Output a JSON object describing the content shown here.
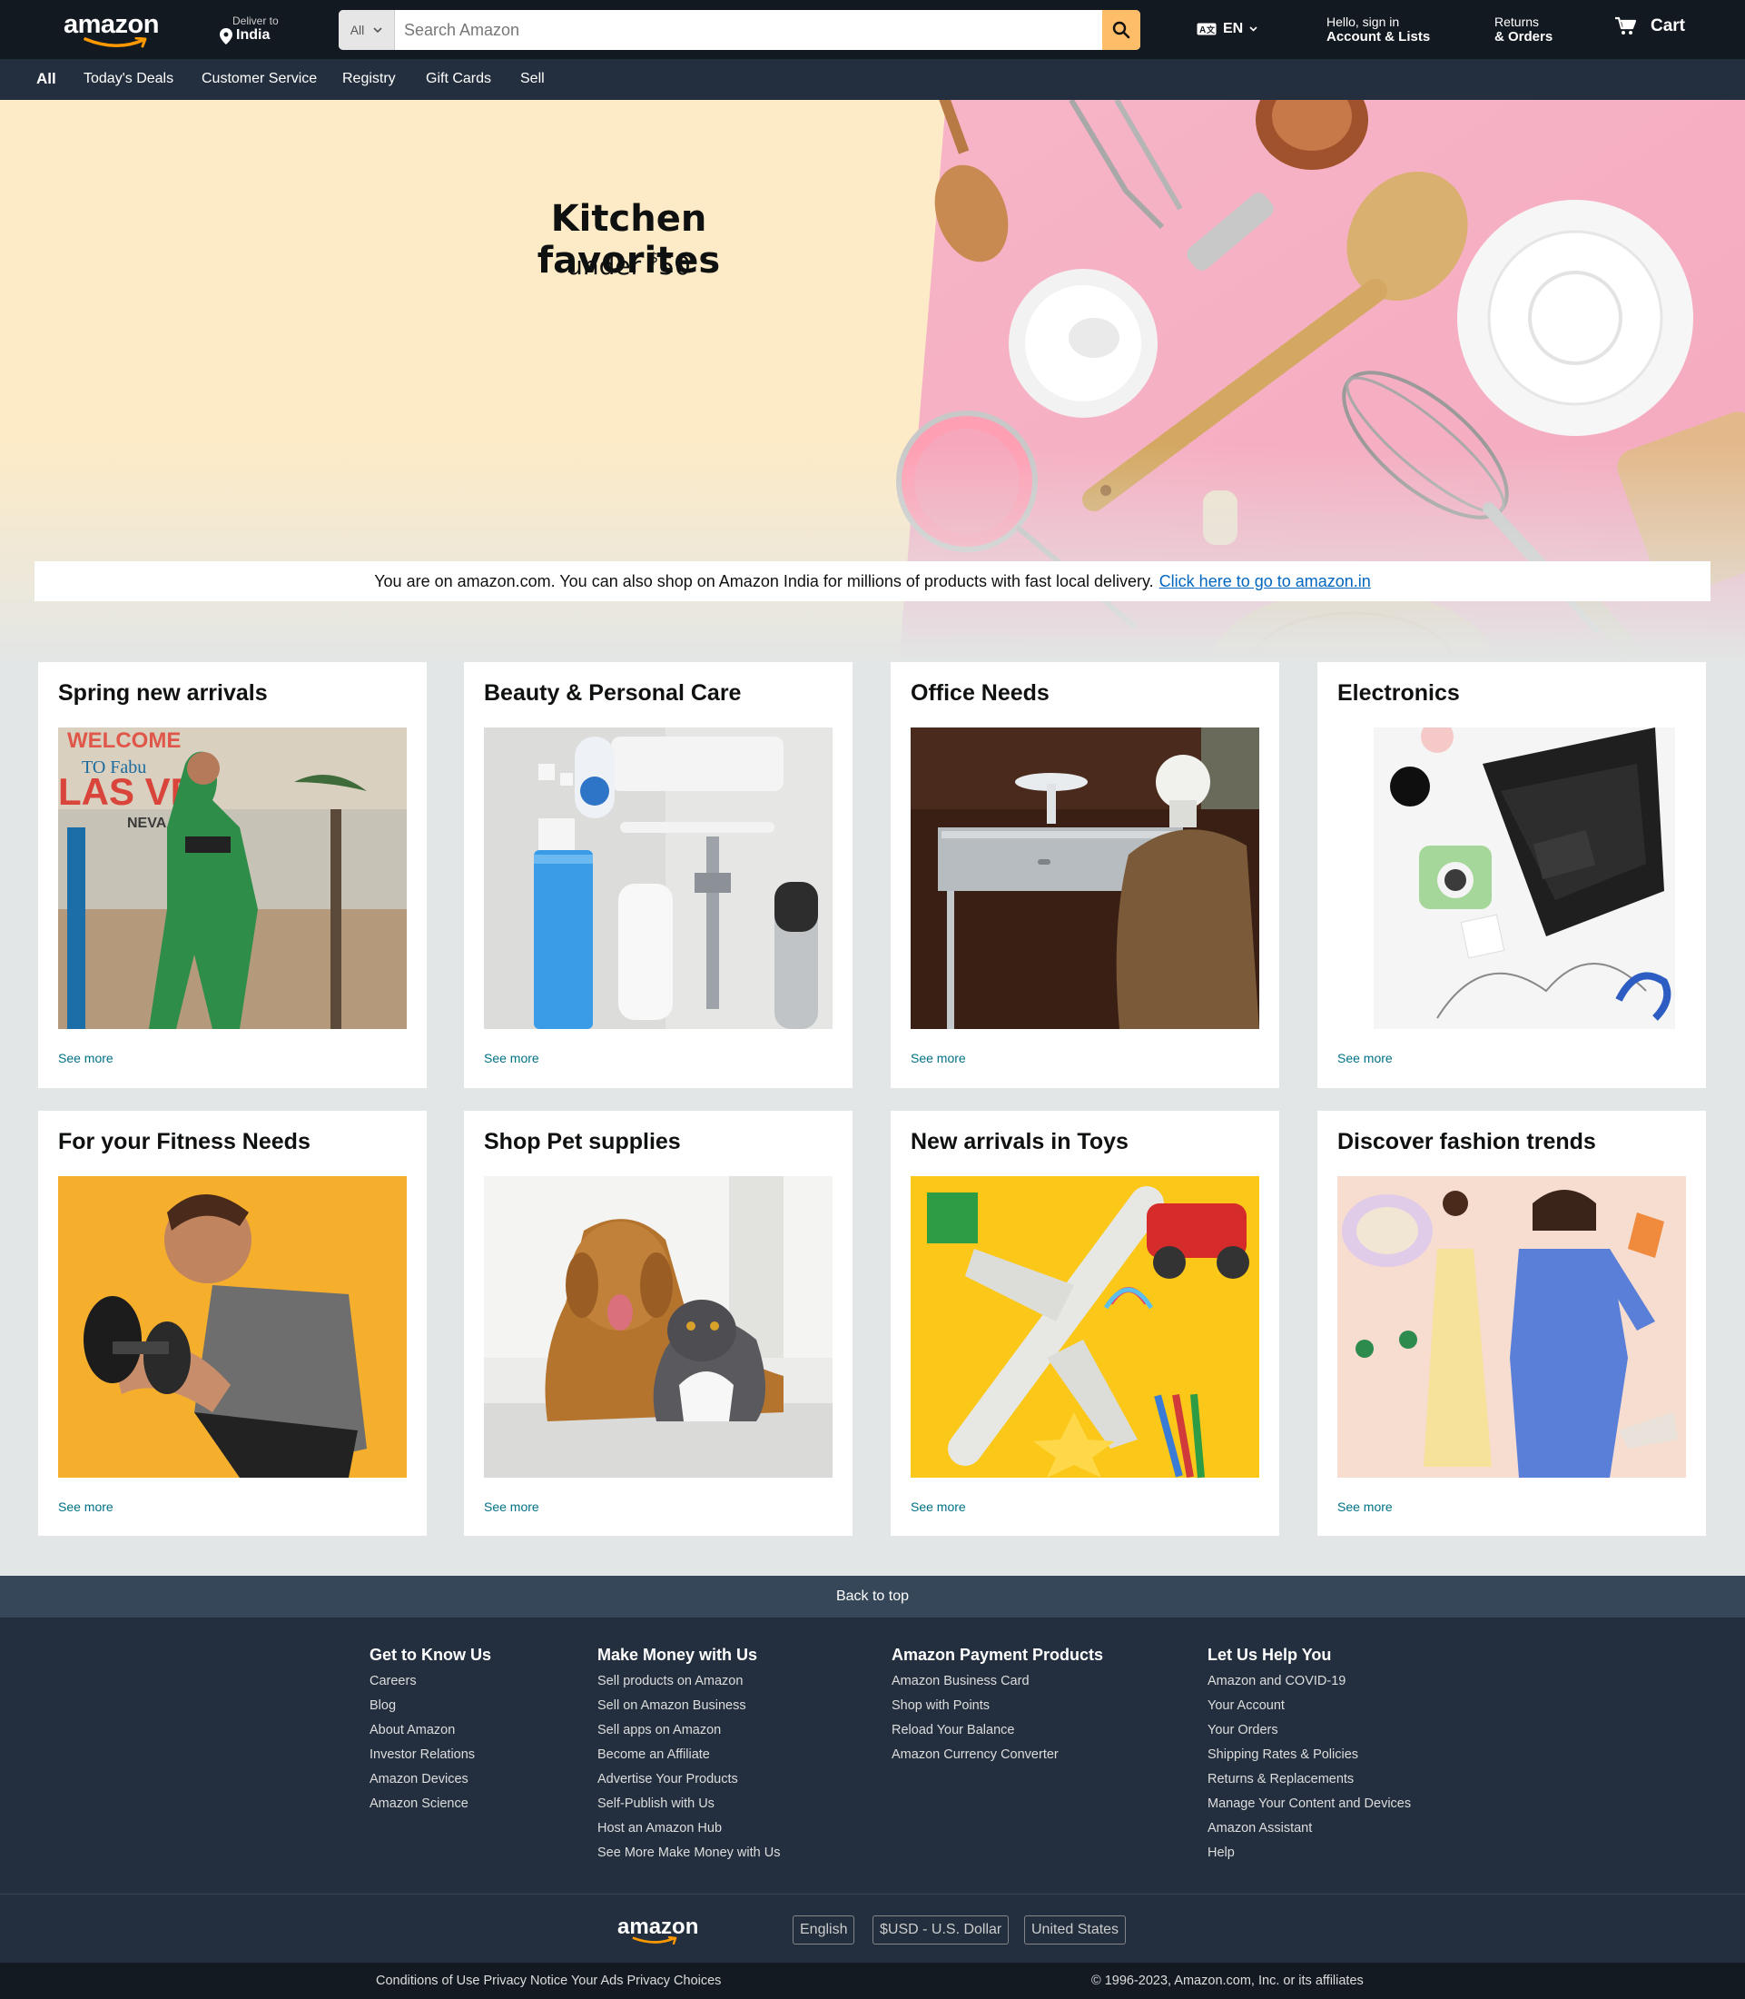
{
  "header": {
    "logo": "amazon",
    "deliver_label": "Deliver to",
    "deliver_location": "India",
    "search_category": "All",
    "search_placeholder": "Search Amazon",
    "language": "EN",
    "account_line1": "Hello, sign in",
    "account_line2": "Account & Lists",
    "returns_line1": "Returns",
    "returns_line2": "& Orders",
    "cart_label": "Cart"
  },
  "subnav": {
    "all": "All",
    "items": [
      "Today's Deals",
      "Customer Service",
      "Registry",
      "Gift Cards",
      "Sell"
    ]
  },
  "hero": {
    "title": "Kitchen favorites",
    "subtitle_prefix": "under ",
    "currency": "$",
    "amount": "50"
  },
  "notice": {
    "text": "You are on amazon.com. You can also shop on Amazon India for millions of products with fast local delivery.",
    "link": "Click here to go to amazon.in"
  },
  "cards": [
    {
      "title": "Spring new arrivals",
      "more": "See more"
    },
    {
      "title": "Beauty & Personal Care",
      "more": "See more"
    },
    {
      "title": "Office Needs",
      "more": "See more"
    },
    {
      "title": "Electronics",
      "more": "See more"
    },
    {
      "title": "For your Fitness Needs",
      "more": "See more"
    },
    {
      "title": "Shop Pet supplies",
      "more": "See more"
    },
    {
      "title": "New arrivals in Toys",
      "more": "See more"
    },
    {
      "title": "Discover fashion trends",
      "more": "See more"
    }
  ],
  "footer": {
    "back_to_top": "Back to top",
    "columns": [
      {
        "heading": "Get to Know Us",
        "links": [
          "Careers",
          "Blog",
          "About Amazon",
          "Investor Relations",
          "Amazon Devices",
          "Amazon Science"
        ]
      },
      {
        "heading": "Make Money with Us",
        "links": [
          "Sell products on Amazon",
          "Sell on Amazon Business",
          "Sell apps on Amazon",
          "Become an Affiliate",
          "Advertise Your Products",
          "Self-Publish with Us",
          "Host an Amazon Hub",
          "See More Make Money with Us"
        ]
      },
      {
        "heading": "Amazon Payment Products",
        "links": [
          "Amazon Business Card",
          "Shop with Points",
          "Reload Your Balance",
          "Amazon Currency Converter"
        ]
      },
      {
        "heading": "Let Us Help You",
        "links": [
          "Amazon and COVID-19",
          "Your Account",
          "Your Orders",
          "Shipping Rates & Policies",
          "Returns & Replacements",
          "Manage Your Content and Devices",
          "Amazon Assistant",
          "Help"
        ]
      }
    ],
    "logo": "amazon",
    "language": "English",
    "currency": "$USD - U.S. Dollar",
    "country": "United States",
    "legal": [
      "Conditions of Use",
      "Privacy Notice",
      "Your Ads Privacy Choices"
    ],
    "copyright": "© 1996-2023, Amazon.com, Inc. or its affiliates"
  },
  "colors": {
    "nav_dark": "#131921",
    "nav_sub": "#232f3e",
    "search_button": "#febd69",
    "link": "#007185",
    "hero_left": "#fdebc7",
    "hero_right": "#f6b8c8"
  }
}
